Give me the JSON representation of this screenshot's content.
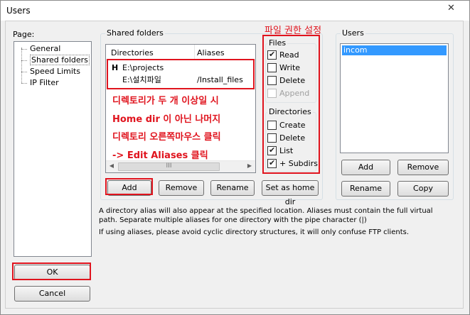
{
  "window": {
    "title": "Users",
    "close_glyph": "✕"
  },
  "page_label": "Page:",
  "tree": {
    "items": [
      {
        "label": "General"
      },
      {
        "label": "Shared folders"
      },
      {
        "label": "Speed Limits"
      },
      {
        "label": "IP Filter"
      }
    ]
  },
  "shared": {
    "group_title": "Shared folders",
    "col_directories": "Directories",
    "col_aliases": "Aliases",
    "rows": [
      {
        "marker": "H",
        "directory": "E:\\projects",
        "alias": ""
      },
      {
        "marker": "",
        "directory": "E:\\설치파일",
        "alias": "/Install_files"
      }
    ],
    "scroll_thumb": "III",
    "scroll_left": "◀",
    "scroll_right": "▶"
  },
  "annotation": {
    "title": "파일 권한 설정",
    "lines": [
      "디렉토리가 두 개 이상일 시",
      "Home dir 이 아닌 나머지",
      "디렉토리 오른쪽마우스 클릭",
      "-> Edit Aliases 클릭"
    ]
  },
  "files": {
    "title": "Files",
    "read": "Read",
    "write": "Write",
    "delete": "Delete",
    "append": "Append"
  },
  "directories": {
    "title": "Directories",
    "create": "Create",
    "delete": "Delete",
    "list": "List",
    "subdirs": "+ Subdirs"
  },
  "users": {
    "title": "Users",
    "items": [
      "incom"
    ]
  },
  "buttons": {
    "add": "Add",
    "remove": "Remove",
    "rename": "Rename",
    "set_home": "Set as home dir",
    "user_add": "Add",
    "user_remove": "Remove",
    "user_rename": "Rename",
    "user_copy": "Copy",
    "ok": "OK",
    "cancel": "Cancel"
  },
  "description": {
    "line1": "A directory alias will also appear at the specified location. Aliases must contain the full virtual",
    "line2": "path. Separate multiple aliases for one directory with the pipe character (|)",
    "line3": "If using aliases, please avoid cyclic directory structures, it will only confuse FTP clients."
  },
  "colors": {
    "highlight_red": "#e0141e",
    "selection_blue": "#3399ff"
  }
}
